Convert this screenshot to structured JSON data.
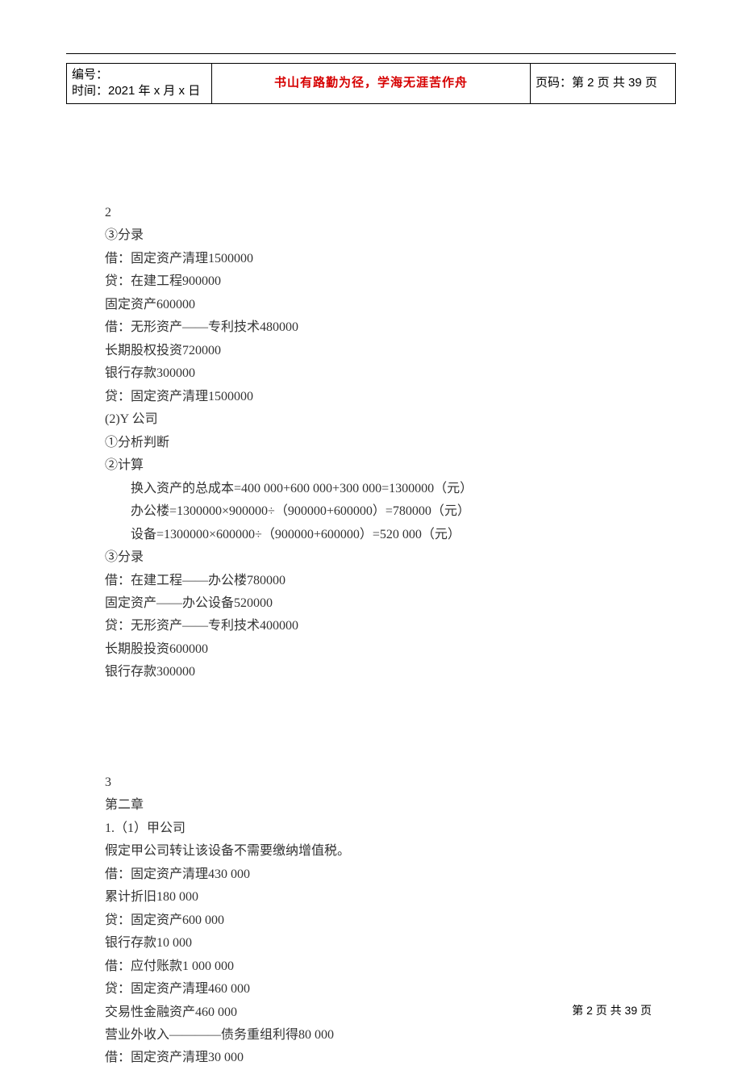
{
  "header": {
    "id_label": "编号：",
    "time_label": "时间：2021 年 x 月 x 日",
    "motto": "书山有路勤为径，学海无涯苦作舟",
    "page_label": "页码：第 2 页  共 39 页"
  },
  "section1": {
    "num": "2",
    "l1": "③分录",
    "l2": "借：固定资产清理1500000",
    "l3": "贷：在建工程900000",
    "l4": "固定资产600000",
    "l5": "借：无形资产——专利技术480000",
    "l6": "长期股权投资720000",
    "l7": "银行存款300000",
    "l8": "贷：固定资产清理1500000",
    "l9": "(2)Y 公司",
    "l10": "①分析判断",
    "l11": "②计算",
    "l12": "换入资产的总成本=400 000+600 000+300 000=1300000（元）",
    "l13": "办公楼=1300000×900000÷（900000+600000）=780000（元）",
    "l14": "设备=1300000×600000÷（900000+600000）=520 000（元）",
    "l15": "③分录",
    "l16": "借：在建工程——办公楼780000",
    "l17": "固定资产——办公设备520000",
    "l18": "贷：无形资产——专利技术400000",
    "l19": "长期股投资600000",
    "l20": "银行存款300000"
  },
  "section2": {
    "num": "3",
    "l1": "第二章",
    "l2": "1.（1）甲公司",
    "l3": "假定甲公司转让该设备不需要缴纳增值税。",
    "l4": "借：固定资产清理430 000",
    "l5": "累计折旧180 000",
    "l6": "贷：固定资产600 000",
    "l7": "银行存款10 000",
    "l8": "借：应付账款1 000 000",
    "l9": "贷：固定资产清理460 000",
    "l10": "交易性金融资产460 000",
    "l11": "营业外收入————债务重组利得80 000",
    "l12": "借：固定资产清理30 000"
  },
  "footer": {
    "text": "第 2 页 共 39 页"
  }
}
